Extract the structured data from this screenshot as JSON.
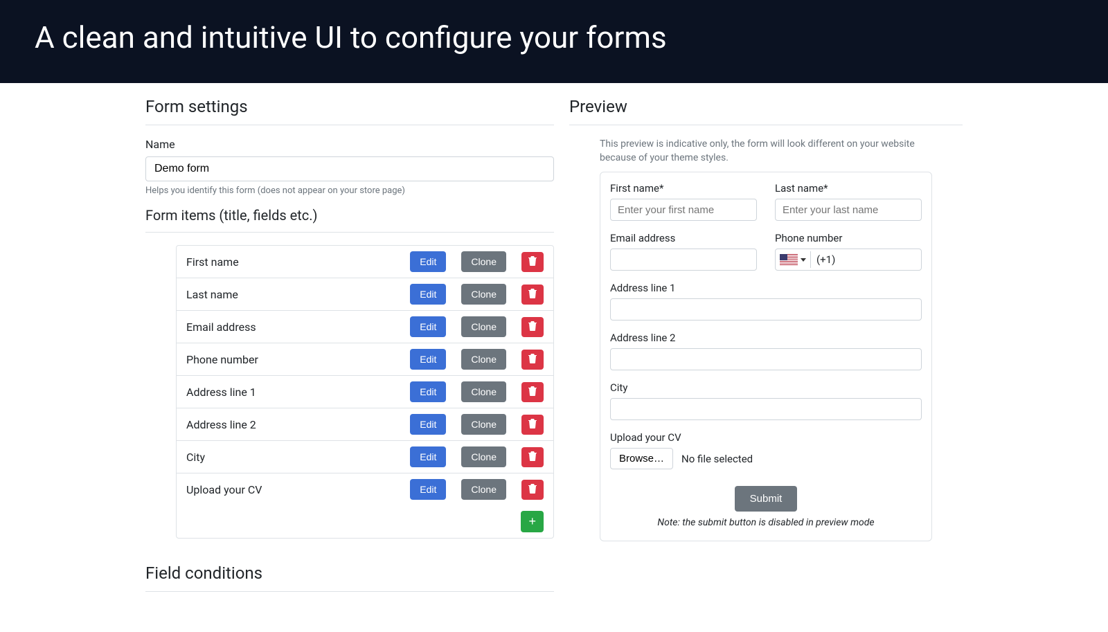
{
  "hero": {
    "title": "A clean and intuitive UI to configure your forms"
  },
  "settings": {
    "heading": "Form settings",
    "name_label": "Name",
    "name_value": "Demo form",
    "name_help": "Helps you identify this form (does not appear on your store page)",
    "items_heading": "Form items (title, fields etc.)",
    "edit_label": "Edit",
    "clone_label": "Clone",
    "add_label": "+",
    "items": [
      {
        "label": "First name"
      },
      {
        "label": "Last name"
      },
      {
        "label": "Email address"
      },
      {
        "label": "Phone number"
      },
      {
        "label": "Address line 1"
      },
      {
        "label": "Address line 2"
      },
      {
        "label": "City"
      },
      {
        "label": "Upload your CV"
      }
    ]
  },
  "conditions": {
    "heading": "Field conditions"
  },
  "preview": {
    "heading": "Preview",
    "hint": "This preview is indicative only, the form will look different on your website because of your theme styles.",
    "first_name_label": "First name*",
    "first_name_placeholder": "Enter your first name",
    "last_name_label": "Last name*",
    "last_name_placeholder": "Enter your last name",
    "email_label": "Email address",
    "phone_label": "Phone number",
    "phone_prefix": "(+1)",
    "addr1_label": "Address line 1",
    "addr2_label": "Address line 2",
    "city_label": "City",
    "upload_label": "Upload your CV",
    "browse_label": "Browse…",
    "no_file_label": "No file selected",
    "submit_label": "Submit",
    "submit_note": "Note: the submit button is disabled in preview mode"
  }
}
